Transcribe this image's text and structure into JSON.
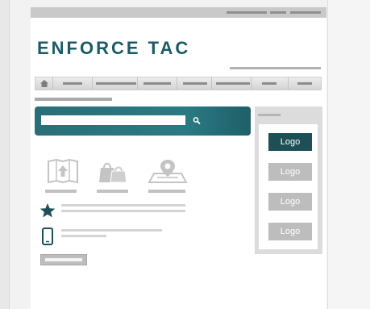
{
  "brand": {
    "logo_text": "ENFORCE TAC",
    "accent_color": "#1b5b66"
  },
  "search": {
    "value": "",
    "placeholder": "",
    "button_icon": "search-icon"
  },
  "nav": {
    "home_icon": "home-icon"
  },
  "features": [
    {
      "icon": "map-upload-icon"
    },
    {
      "icon": "shopping-bags-icon"
    },
    {
      "icon": "map-pin-icon"
    }
  ],
  "info_rows": [
    {
      "icon": "star-icon"
    },
    {
      "icon": "mobile-phone-icon"
    }
  ],
  "sponsors": {
    "buttons": [
      {
        "label": "Logo",
        "state": "active"
      },
      {
        "label": "Logo",
        "state": "inactive"
      },
      {
        "label": "Logo",
        "state": "inactive"
      },
      {
        "label": "Logo",
        "state": "inactive"
      }
    ]
  }
}
